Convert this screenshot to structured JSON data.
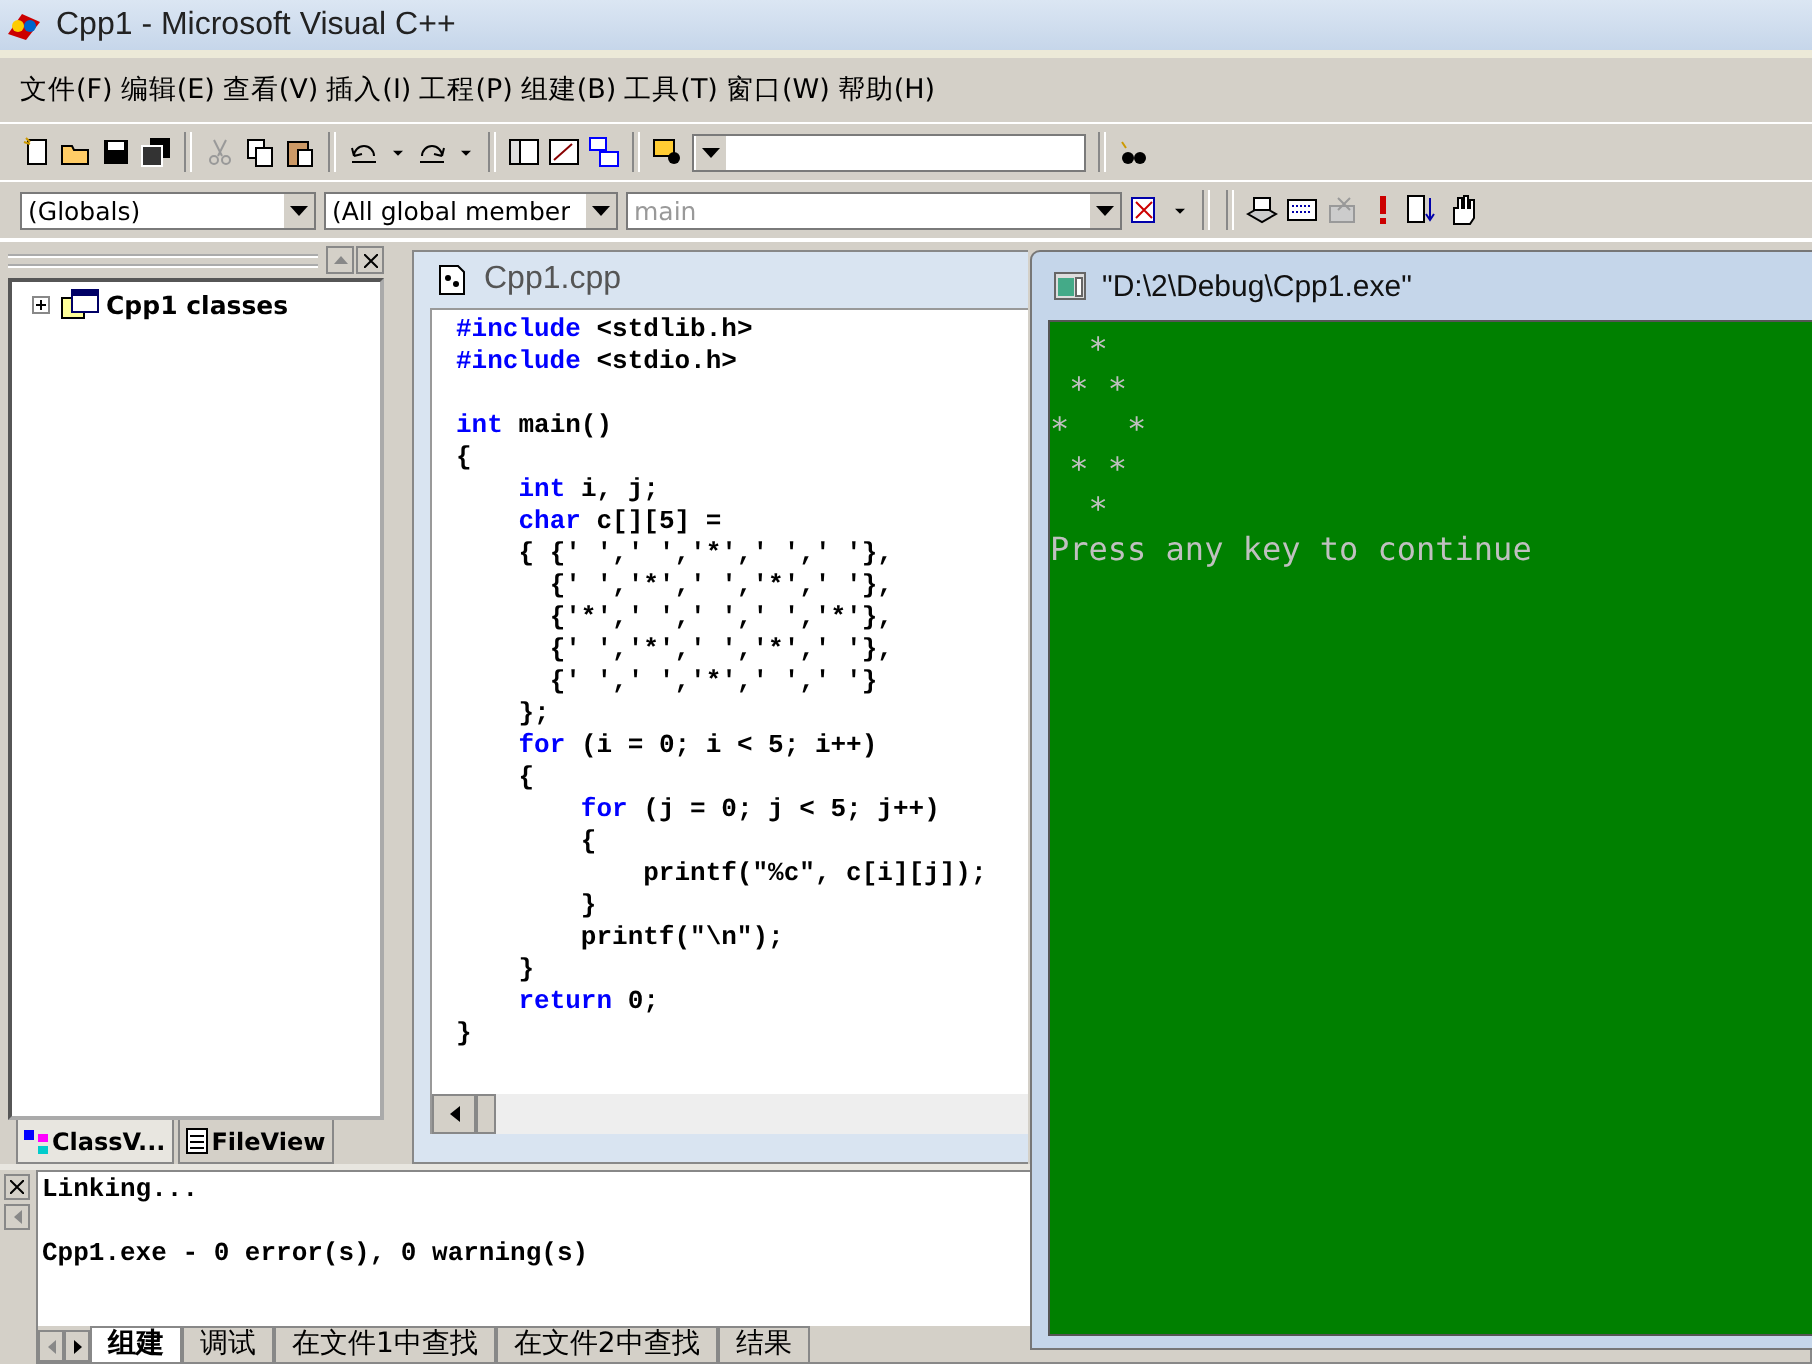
{
  "window": {
    "title": "Cpp1 - Microsoft Visual C++"
  },
  "menu": [
    "文件(F)",
    "编辑(E)",
    "查看(V)",
    "插入(I)",
    "工程(P)",
    "组建(B)",
    "工具(T)",
    "窗口(W)",
    "帮助(H)"
  ],
  "wizard_bar": [
    {
      "value": "(Globals)",
      "disabled": false
    },
    {
      "value": "(All global member",
      "disabled": false
    },
    {
      "value": "main",
      "disabled": true
    }
  ],
  "workspace": {
    "tree": [
      {
        "label": "Cpp1 classes",
        "expanded": false
      }
    ],
    "tabs": [
      {
        "label": "ClassV...",
        "selected": true
      },
      {
        "label": "FileView",
        "selected": false
      }
    ]
  },
  "editor": {
    "title": "Cpp1.cpp",
    "lines": [
      {
        "segments": [
          {
            "text": "#include",
            "kind": "keyword"
          },
          {
            "text": " <stdlib.h>",
            "kind": "plain"
          }
        ]
      },
      {
        "segments": [
          {
            "text": "#include",
            "kind": "keyword"
          },
          {
            "text": " <stdio.h>",
            "kind": "plain"
          }
        ]
      },
      {
        "blank_before": true,
        "segments": [
          {
            "text": "int",
            "kind": "keyword"
          },
          {
            "text": " main()",
            "kind": "plain"
          }
        ]
      },
      {
        "segments": [
          {
            "text": "{",
            "kind": "plain"
          }
        ]
      },
      {
        "segments": [
          {
            "text": "    int",
            "kind": "keyword"
          },
          {
            "text": " i, j;",
            "kind": "plain"
          }
        ]
      },
      {
        "segments": [
          {
            "text": "    char",
            "kind": "keyword"
          },
          {
            "text": " c[][5] =",
            "kind": "plain"
          }
        ]
      },
      {
        "segments": [
          {
            "text": "    { {' ',' ','*',' ',' '},",
            "kind": "plain"
          }
        ]
      },
      {
        "segments": [
          {
            "text": "      {' ','*',' ','*',' '},",
            "kind": "plain"
          }
        ]
      },
      {
        "segments": [
          {
            "text": "      {'*',' ',' ',' ','*'},",
            "kind": "plain"
          }
        ]
      },
      {
        "segments": [
          {
            "text": "      {' ','*',' ','*',' '},",
            "kind": "plain"
          }
        ]
      },
      {
        "segments": [
          {
            "text": "      {' ',' ','*',' ',' '}",
            "kind": "plain"
          }
        ]
      },
      {
        "segments": [
          {
            "text": "    };",
            "kind": "plain"
          }
        ]
      },
      {
        "segments": [
          {
            "text": "    for",
            "kind": "keyword"
          },
          {
            "text": " (i = 0; i < 5; i++)",
            "kind": "plain"
          }
        ]
      },
      {
        "segments": [
          {
            "text": "    {",
            "kind": "plain"
          }
        ]
      },
      {
        "segments": [
          {
            "text": "        for",
            "kind": "keyword"
          },
          {
            "text": " (j = 0; j < 5; j++)",
            "kind": "plain"
          }
        ]
      },
      {
        "segments": [
          {
            "text": "        {",
            "kind": "plain"
          }
        ]
      },
      {
        "segments": [
          {
            "text": "            printf(\"%c\", c[i][j]);",
            "kind": "plain"
          }
        ]
      },
      {
        "segments": [
          {
            "text": "        }",
            "kind": "plain"
          }
        ]
      },
      {
        "segments": [
          {
            "text": "        printf(\"\\n\");",
            "kind": "plain"
          }
        ]
      },
      {
        "segments": [
          {
            "text": "    }",
            "kind": "plain"
          }
        ]
      },
      {
        "segments": [
          {
            "text": "    return",
            "kind": "keyword"
          },
          {
            "text": " 0;",
            "kind": "plain"
          }
        ]
      },
      {
        "segments": [
          {
            "text": "}",
            "kind": "plain"
          }
        ]
      }
    ]
  },
  "output": {
    "lines": [
      {
        "text": "Linking..."
      },
      {
        "text": "Cpp1.exe - 0 error(s), 0 warning(s)",
        "blank_before": true
      }
    ],
    "tabs": [
      {
        "label": "组建",
        "selected": true
      },
      {
        "label": "调试",
        "selected": false
      },
      {
        "label": "在文件1中查找",
        "selected": false
      },
      {
        "label": "在文件2中查找",
        "selected": false
      },
      {
        "label": "结果",
        "selected": false
      }
    ]
  },
  "console": {
    "title": "\"D:\\2\\Debug\\Cpp1.exe\"",
    "output": "  *\n * *\n*   *\n * *\n  *\nPress any key to continue"
  }
}
